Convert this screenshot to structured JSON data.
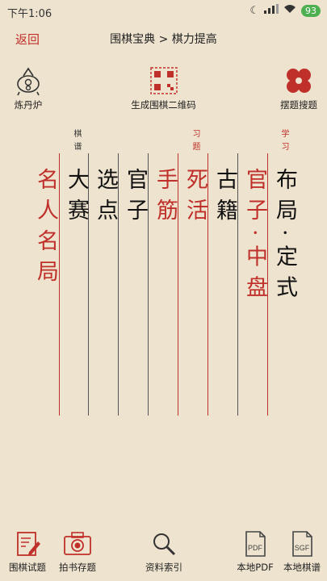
{
  "status": {
    "time": "下午1:06",
    "battery": "93"
  },
  "nav": {
    "back_label": "返回",
    "title": "围棋宝典 > 棋力提高"
  },
  "tools": {
    "left_label": "炼丹炉",
    "center_label": "生成围棋二维码",
    "right_label": "摆题搜题"
  },
  "columns": [
    {
      "text": "名人名局",
      "color": "red"
    },
    {
      "text": "大赛",
      "color": "black"
    },
    {
      "text": "选点",
      "color": "black"
    },
    {
      "text": "官子",
      "color": "black"
    },
    {
      "text": "手筋",
      "color": "red"
    },
    {
      "text": "死活",
      "color": "red"
    },
    {
      "text": "古籍",
      "color": "black"
    },
    {
      "text": "官子·中盘",
      "color": "red"
    },
    {
      "text": "布局·定式",
      "color": "black"
    }
  ],
  "tags": [
    {
      "text": "棋谱",
      "color": "black"
    },
    {
      "text": "习题",
      "color": "red"
    },
    {
      "text": "学习",
      "color": "red"
    }
  ],
  "bottom": {
    "tab1": "围棋试题",
    "tab2": "拍书存题",
    "tab3": "资料索引",
    "tab4": "本地PDF",
    "tab5": "本地棋谱"
  },
  "icons": {
    "pdf_text": "PDF",
    "sgf_text": "SGF"
  }
}
